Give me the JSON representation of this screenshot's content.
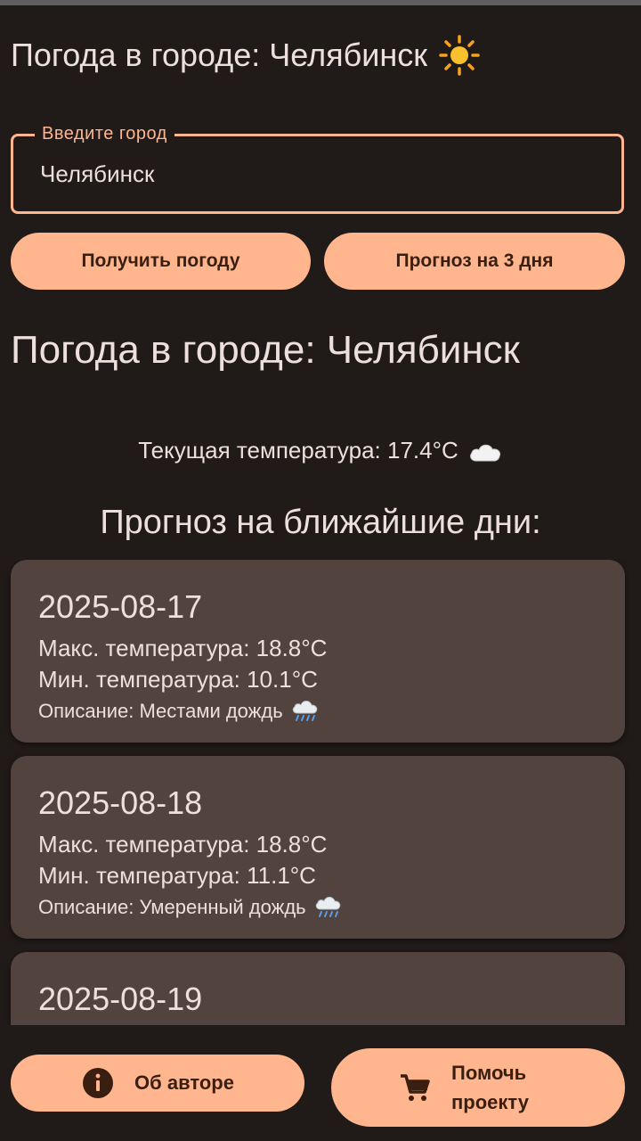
{
  "app": {
    "title": "Погода в городе: Челябинск",
    "title_icon": "sun-icon"
  },
  "search": {
    "label": "Введите город",
    "value": "Челябинск"
  },
  "actions": {
    "get_weather_label": "Получить погоду",
    "forecast_3days_label": "Прогноз на 3 дня"
  },
  "result": {
    "title": "Погода в городе: Челябинск",
    "current_temp_text": "Текущая температура: 17.4°C",
    "current_icon": "cloud-icon",
    "forecast_heading": "Прогноз на ближайшие дни:"
  },
  "forecast": [
    {
      "date": "2025-08-17",
      "max": "Макс. температура: 18.8°C",
      "min": "Мин. температура: 10.1°C",
      "description": "Описание: Местами дождь",
      "icon": "rain-icon"
    },
    {
      "date": "2025-08-18",
      "max": "Макс. температура: 18.8°C",
      "min": "Мин. температура: 11.1°C",
      "description": "Описание: Умеренный дождь",
      "icon": "rain-icon"
    },
    {
      "date": "2025-08-19"
    }
  ],
  "footer": {
    "author_label": "Об авторе",
    "author_icon": "info-icon",
    "help_label": "Помочь проекту",
    "help_icon": "cart-icon"
  },
  "colors": {
    "background": "#201a18",
    "accent": "#ffb68f",
    "card": "#52433e",
    "text": "#ede0dc",
    "button_text": "#3a1f10"
  }
}
